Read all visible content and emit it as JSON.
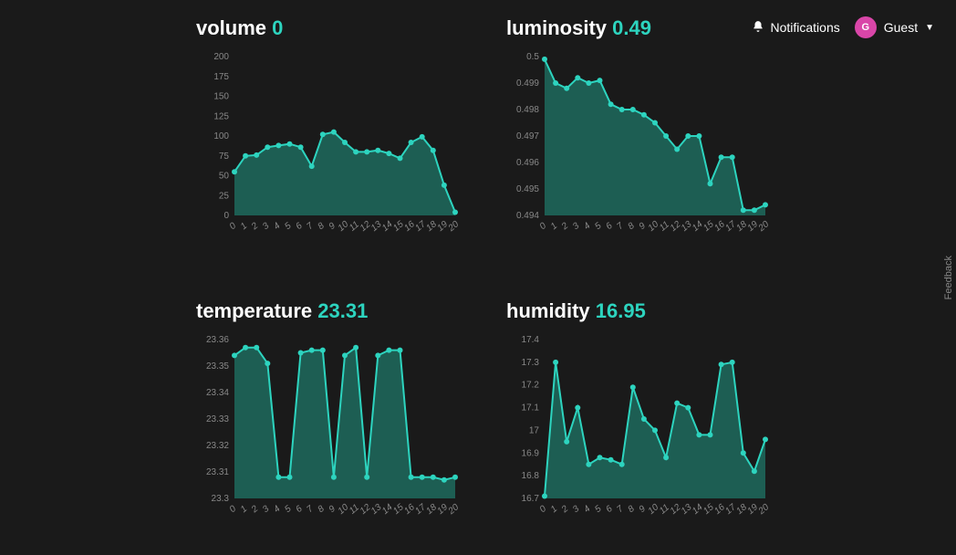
{
  "header": {
    "notifications_label": "Notifications",
    "avatar_letter": "G",
    "user_label": "Guest"
  },
  "feedback_label": "Feedback",
  "panels": {
    "volume": {
      "title": "volume",
      "value": "0"
    },
    "luminosity": {
      "title": "luminosity",
      "value": "0.49"
    },
    "temperature": {
      "title": "temperature",
      "value": "23.31"
    },
    "humidity": {
      "title": "humidity",
      "value": "16.95"
    }
  },
  "chart_data": [
    {
      "id": "volume",
      "type": "area",
      "title": "volume",
      "current": 0,
      "ylim": [
        0,
        200
      ],
      "yticks": [
        0,
        25,
        50,
        75,
        100,
        125,
        150,
        175,
        200
      ],
      "x": [
        0,
        1,
        2,
        3,
        4,
        5,
        6,
        7,
        8,
        9,
        10,
        11,
        12,
        13,
        14,
        15,
        16,
        17,
        18,
        19,
        20
      ],
      "values": [
        55,
        75,
        76,
        86,
        88,
        90,
        86,
        62,
        102,
        105,
        92,
        80,
        80,
        82,
        78,
        72,
        92,
        99,
        82,
        38,
        4
      ]
    },
    {
      "id": "luminosity",
      "type": "area",
      "title": "luminosity",
      "current": 0.49,
      "ylim": [
        0.494,
        0.5
      ],
      "yticks": [
        0.494,
        0.495,
        0.496,
        0.497,
        0.498,
        0.499,
        0.5
      ],
      "x": [
        0,
        1,
        2,
        3,
        4,
        5,
        6,
        7,
        8,
        9,
        10,
        11,
        12,
        13,
        14,
        15,
        16,
        17,
        18,
        19,
        20
      ],
      "values": [
        0.4999,
        0.499,
        0.4988,
        0.4992,
        0.499,
        0.4991,
        0.4982,
        0.498,
        0.498,
        0.4978,
        0.4975,
        0.497,
        0.4965,
        0.497,
        0.497,
        0.4952,
        0.4962,
        0.4962,
        0.4942,
        0.4942,
        0.4944
      ]
    },
    {
      "id": "temperature",
      "type": "area",
      "title": "temperature",
      "current": 23.31,
      "ylim": [
        23.3,
        23.36
      ],
      "yticks": [
        23.3,
        23.31,
        23.32,
        23.33,
        23.34,
        23.35,
        23.36
      ],
      "x": [
        0,
        1,
        2,
        3,
        4,
        5,
        6,
        7,
        8,
        9,
        10,
        11,
        12,
        13,
        14,
        15,
        16,
        17,
        18,
        19,
        20
      ],
      "values": [
        23.354,
        23.357,
        23.357,
        23.351,
        23.308,
        23.308,
        23.355,
        23.356,
        23.356,
        23.308,
        23.354,
        23.357,
        23.308,
        23.354,
        23.356,
        23.356,
        23.308,
        23.308,
        23.308,
        23.307,
        23.308
      ]
    },
    {
      "id": "humidity",
      "type": "area",
      "title": "humidity",
      "current": 16.95,
      "ylim": [
        16.7,
        17.4
      ],
      "yticks": [
        16.7,
        16.8,
        16.9,
        17.0,
        17.1,
        17.2,
        17.3,
        17.4
      ],
      "x": [
        0,
        1,
        2,
        3,
        4,
        5,
        6,
        7,
        8,
        9,
        10,
        11,
        12,
        13,
        14,
        15,
        16,
        17,
        18,
        19,
        20
      ],
      "values": [
        16.71,
        17.3,
        16.95,
        17.1,
        16.85,
        16.88,
        16.87,
        16.85,
        17.19,
        17.05,
        17.0,
        16.88,
        17.12,
        17.1,
        16.98,
        16.98,
        17.29,
        17.3,
        16.9,
        16.82,
        16.96
      ]
    }
  ]
}
